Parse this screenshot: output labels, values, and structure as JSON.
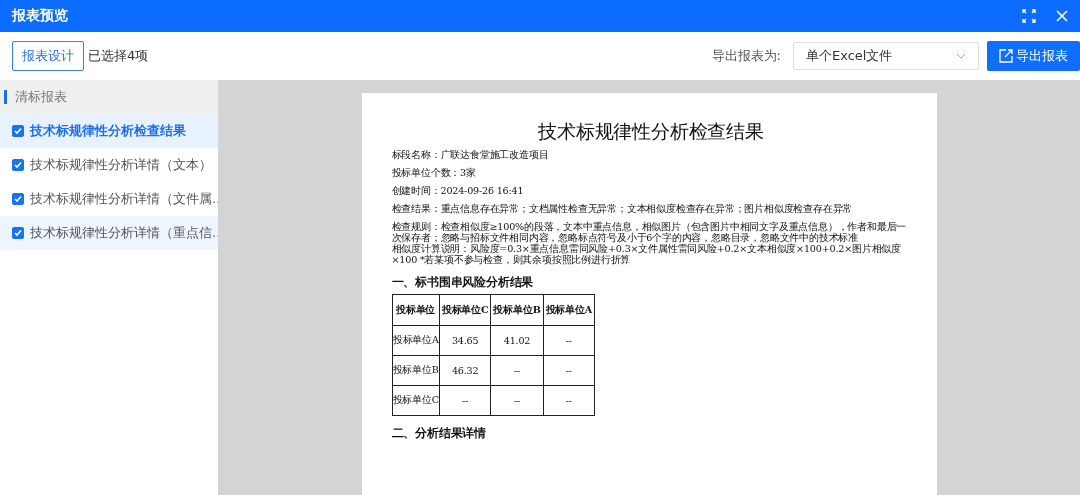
{
  "window": {
    "title": "报表预览"
  },
  "toolbar": {
    "design_button": "报表设计",
    "selection_count": "已选择4项",
    "export_label": "导出报表为:",
    "export_format": {
      "value": "单个Excel文件"
    },
    "export_button": "导出报表"
  },
  "sidebar": {
    "group": "清标报表",
    "items": [
      {
        "label": "技术标规律性分析检查结果",
        "checked": true,
        "selected": true
      },
      {
        "label": "技术标规律性分析详情（文本）",
        "checked": true,
        "selected": false
      },
      {
        "label": "技术标规律性分析详情（文件属…",
        "checked": true,
        "selected": false
      },
      {
        "label": "技术标规律性分析详情（重点信…",
        "checked": true,
        "selected": false
      }
    ]
  },
  "document": {
    "title": "技术标规律性分析检查结果",
    "lines": [
      {
        "text": "标段名称：广联达食堂施工改造项目",
        "kind": "field"
      },
      {
        "text": "投标单位个数：3家",
        "kind": "field"
      },
      {
        "text": "创建时间：2024-09-26 16:41",
        "kind": "field"
      },
      {
        "text": "检查结果：重点信息存在异常；文档属性检查无异常；文本相似度检查存在异常；图片相似度检查存在异常",
        "kind": "field"
      },
      {
        "text": "检查规则：检查相似度≥100%的段落，文本中重点信息，相似图片（包含图片中相同文字及重点信息），作者和最后一次保存者；忽略与招标文件相同内容，忽略标点符号及小于6个字的内容，忽略目录，忽略文件中的技术标准",
        "kind": "note"
      },
      {
        "text": "相似度计算说明：风险度=0.3×重点信息雷同风险+0.3×文件属性雷同风险+0.2×文本相似度×100+0.2×图片相似度×100 *若某项不参与检查，则其余项按照比例进行折算",
        "kind": "note"
      }
    ],
    "sections": [
      {
        "heading": "一、标书围串风险分析结果",
        "table": {
          "columns": [
            "投标单位",
            "投标单位C",
            "投标单位B",
            "投标单位A"
          ],
          "rows": [
            [
              "投标单位A",
              "34.65",
              "41.02",
              "--"
            ],
            [
              "投标单位B",
              "46.32",
              "--",
              "--"
            ],
            [
              "投标单位C",
              "--",
              "--",
              "--"
            ]
          ]
        }
      },
      {
        "heading": "二、分析结果详情"
      }
    ]
  }
}
